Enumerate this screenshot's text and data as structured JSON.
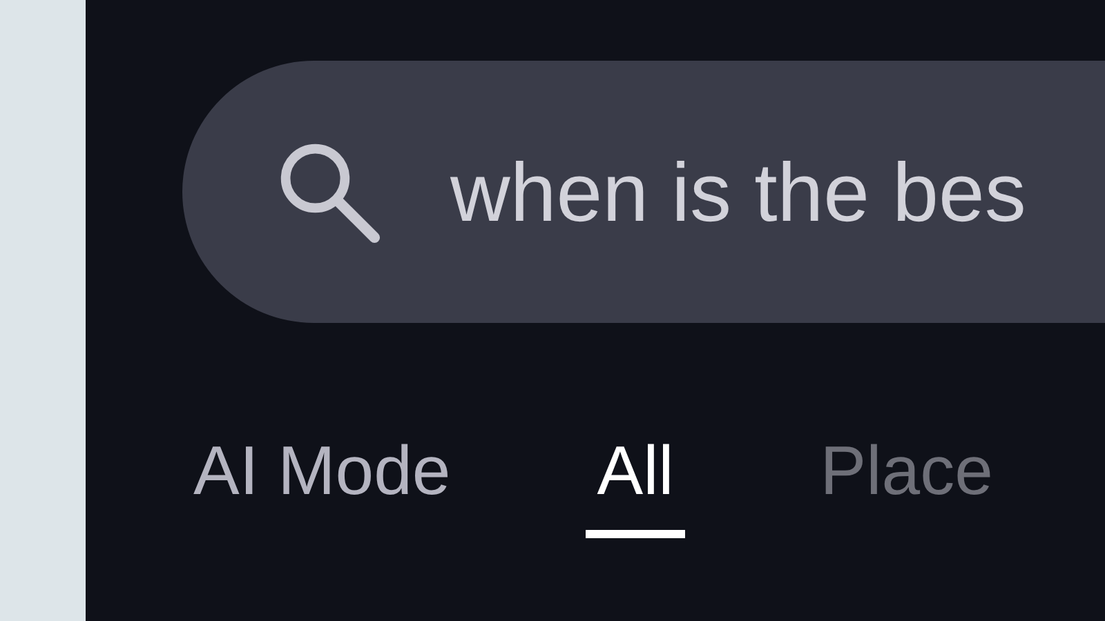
{
  "search": {
    "value": "when is the bes"
  },
  "tabs": [
    {
      "label": "AI Mode",
      "selected": false
    },
    {
      "label": "All",
      "selected": true
    },
    {
      "label": "Place",
      "selected": false
    }
  ]
}
